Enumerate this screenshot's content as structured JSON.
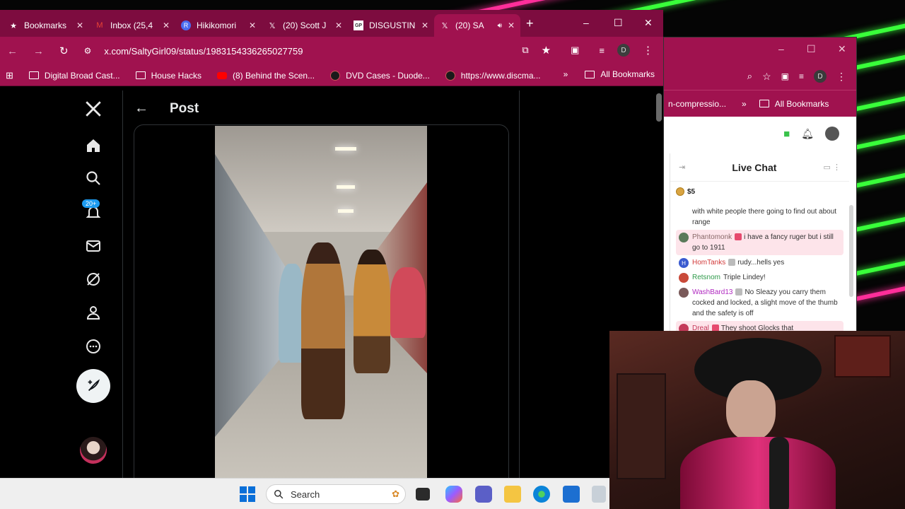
{
  "browser": {
    "tabs": [
      {
        "label": "Bookmarks",
        "icon": "star-icon"
      },
      {
        "label": "Inbox (25,4",
        "icon": "gmail-icon"
      },
      {
        "label": "Hikikomori",
        "icon": "r-icon"
      },
      {
        "label": "(20) Scott J",
        "icon": "x-logo-icon"
      },
      {
        "label": "DISGUSTIN",
        "icon": "gp-icon"
      },
      {
        "label": "(20) SA",
        "icon": "x-logo-icon"
      }
    ],
    "url": "x.com/SaltyGirl09/status/1983154336265027759",
    "profile_initial": "D",
    "bookmarks": [
      {
        "label": "Digital Broad Cast...",
        "icon": "folder-icon"
      },
      {
        "label": "House Hacks",
        "icon": "folder-icon"
      },
      {
        "label": "(8) Behind the Scen...",
        "icon": "youtube-icon"
      },
      {
        "label": "DVD Cases - Duode...",
        "icon": "site-icon"
      },
      {
        "label": "https://www.discma...",
        "icon": "site-icon"
      }
    ],
    "all_bookmarks": "All Bookmarks"
  },
  "xpage": {
    "title": "Post",
    "notif_count": "20+"
  },
  "second_window": {
    "bookmark_partial": "n-compressio...",
    "all_bookmarks": "All Bookmarks",
    "profile_initial": "D"
  },
  "chat": {
    "title": "Live Chat",
    "top_money": "$5",
    "messages": [
      {
        "name": "",
        "text": "with white people there going to find out about range",
        "color": "#333333",
        "highlight": false
      },
      {
        "name": "Phantomonk",
        "text": "i have a fancy ruger but i still go to 1911",
        "color": "#8a6a6a",
        "highlight": true
      },
      {
        "name": "HomTanks",
        "text": "rudy...hells yes",
        "color": "#d23a3a",
        "highlight": false
      },
      {
        "name": "Retsnom",
        "text": "Triple Lindey!",
        "color": "#2e9a4a",
        "highlight": false
      },
      {
        "name": "WashBard13",
        "text": "No Sleazy you carry them cocked and locked, a slight move of the thumb and the safety is off",
        "color": "#b02ac0",
        "highlight": false
      },
      {
        "name": "Dreal",
        "text": "They shoot Glocks that",
        "color": "#c43a5a",
        "highlight": true
      }
    ]
  },
  "taskbar": {
    "search_label": "Search"
  }
}
